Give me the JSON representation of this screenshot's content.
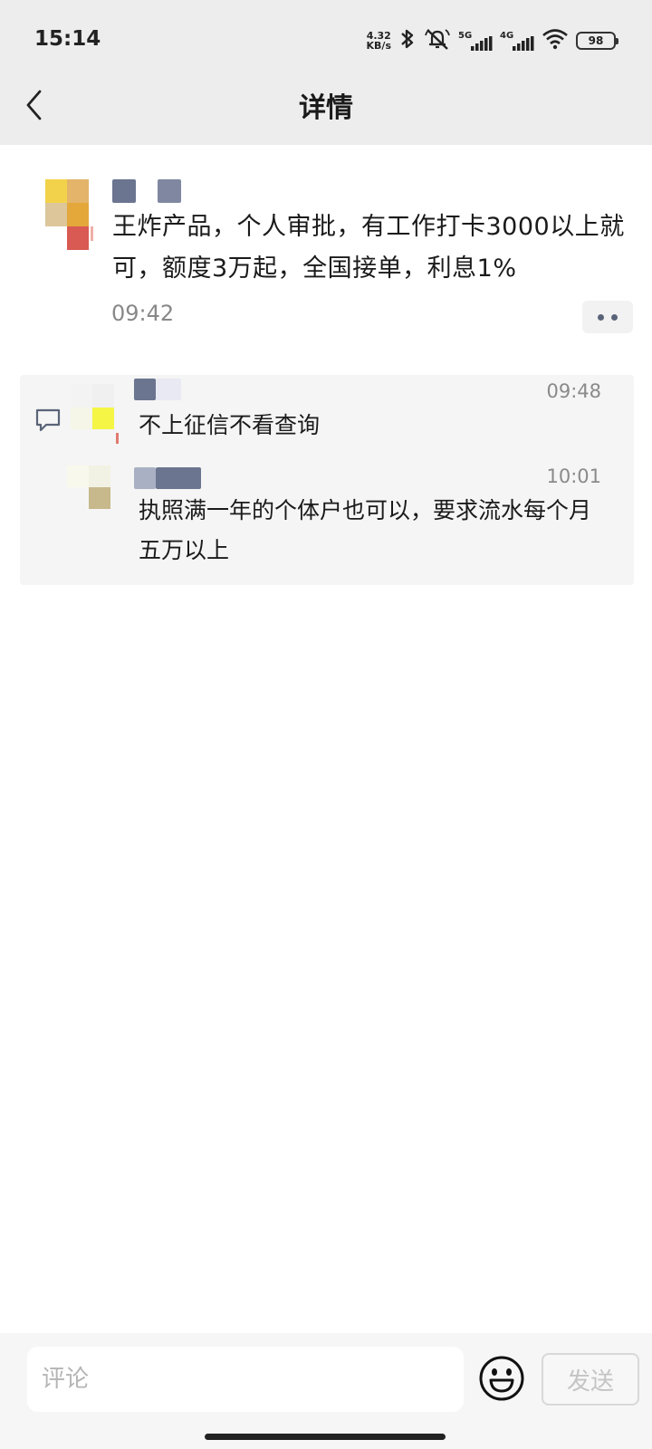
{
  "status_bar": {
    "time": "15:14",
    "net_speed_value": "4.32",
    "net_speed_unit": "KB/s",
    "signal_1_label": "5G",
    "signal_2_label": "4G",
    "battery_level": "98"
  },
  "nav": {
    "title": "详情",
    "back_icon": "chevron-left-icon"
  },
  "post": {
    "text": "王炸产品，个人审批，有工作打卡3000以上就可，额度3万起，全国接单，利息1%",
    "time": "09:42",
    "more_icon": "more-dots-icon"
  },
  "comments": [
    {
      "time": "09:48",
      "text": "不上征信不看查询"
    },
    {
      "time": "10:01",
      "text": "执照满一年的个体户也可以，要求流水每个月五万以上"
    }
  ],
  "input_bar": {
    "placeholder": "评论",
    "send_label": "发送",
    "emoji_icon": "emoji-icon"
  },
  "colors": {
    "header_bg": "#ededed",
    "comment_bg": "#f5f5f5",
    "time_gray": "#888888",
    "send_disabled": "#c4c4c4"
  }
}
